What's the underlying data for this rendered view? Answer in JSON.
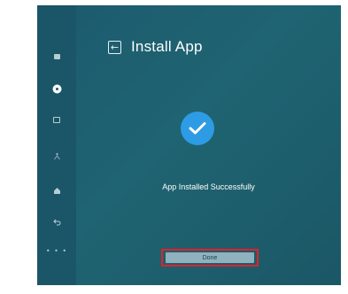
{
  "header": {
    "back_icon": "arrow-left-icon",
    "title": "Install App"
  },
  "sidebar": {
    "items": [
      {
        "icon": "square-icon",
        "active": false
      },
      {
        "icon": "gear-icon",
        "active": true
      },
      {
        "icon": "screen-icon",
        "active": false
      },
      {
        "icon": "accessibility-icon",
        "active": false
      },
      {
        "icon": "home-icon",
        "active": false
      },
      {
        "icon": "back-icon",
        "active": false
      },
      {
        "icon": "more-icon",
        "label": "• • •",
        "active": false
      }
    ]
  },
  "main": {
    "status_icon": "checkmark-icon",
    "status_text": "App Installed Successfully",
    "done_label": "Done"
  },
  "colors": {
    "background": "#1f6472",
    "sidebar": "#1b5568",
    "accent": "#2e9be5",
    "highlight": "#e3202a",
    "button": "#8fb2be"
  }
}
